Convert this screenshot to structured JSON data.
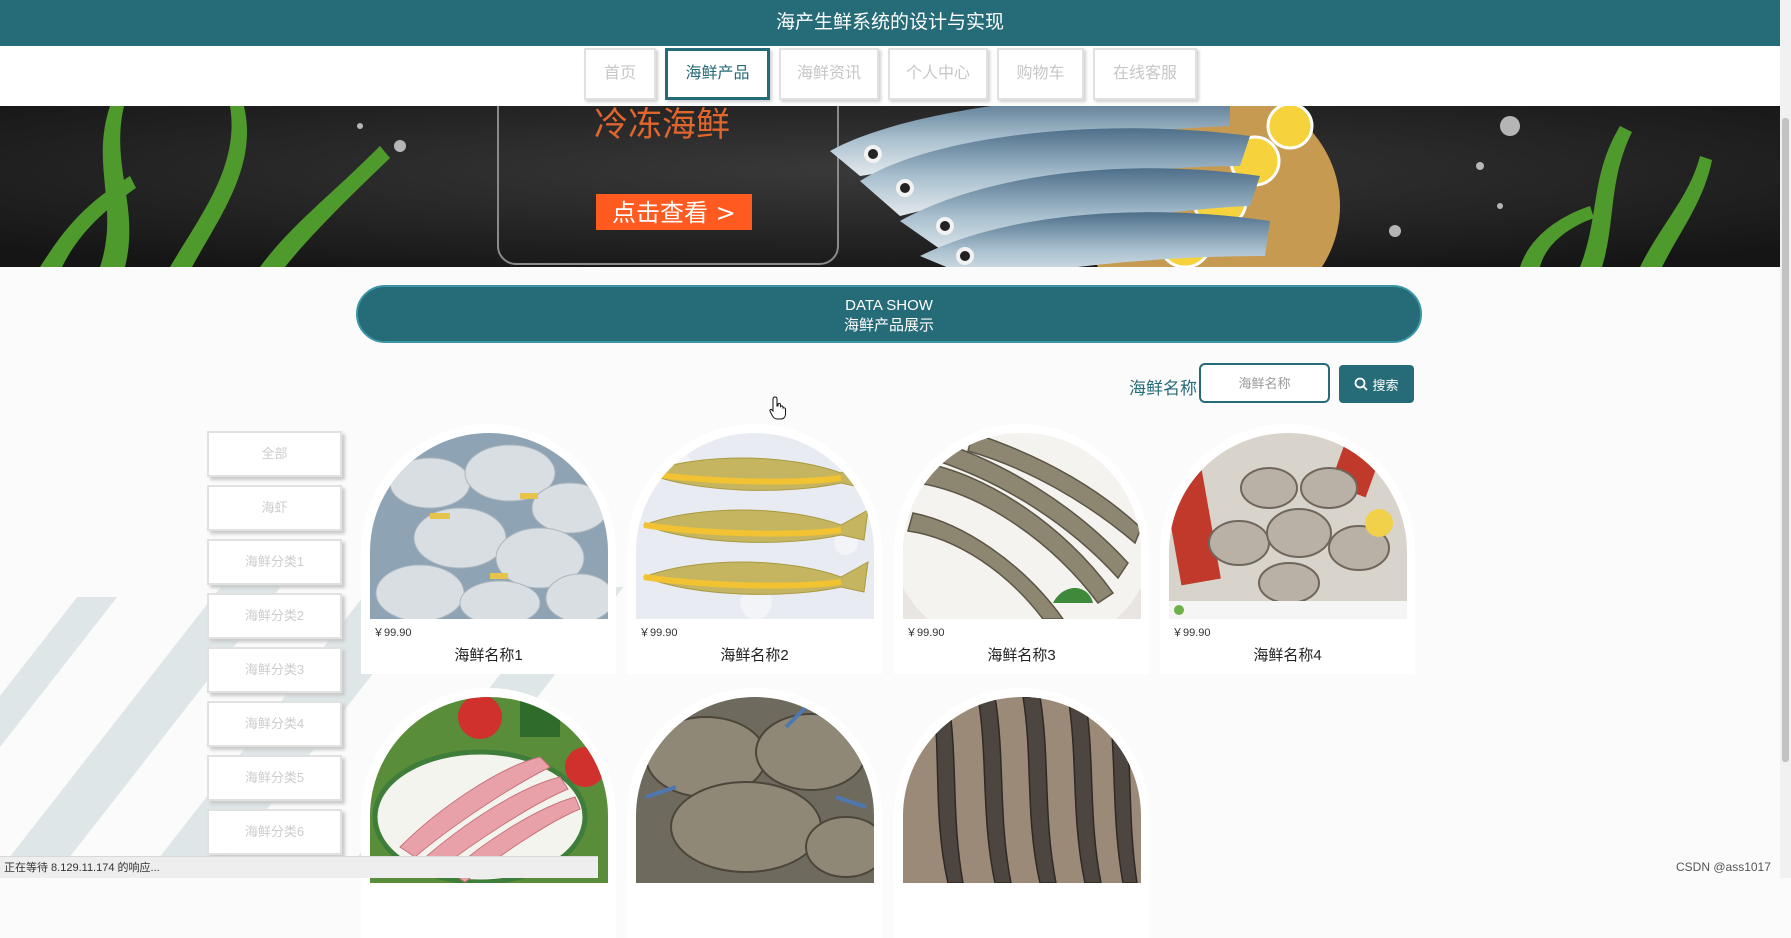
{
  "header": {
    "title": "海产生鲜系统的设计与实现"
  },
  "nav": {
    "items": [
      {
        "label": "首页",
        "active": false
      },
      {
        "label": "海鲜产品",
        "active": true
      },
      {
        "label": "海鲜资讯",
        "active": false
      },
      {
        "label": "个人中心",
        "active": false
      },
      {
        "label": "购物车",
        "active": false
      },
      {
        "label": "在线客服",
        "active": false
      }
    ]
  },
  "banner": {
    "headline": "冷冻海鲜",
    "cta": "点击查看 >"
  },
  "section": {
    "title_en": "DATA SHOW",
    "title_zh": "海鲜产品展示"
  },
  "search": {
    "label": "海鲜名称",
    "placeholder": "海鲜名称",
    "button": "搜索",
    "icon": "search-icon"
  },
  "categories": [
    "全部",
    "海虾",
    "海鲜分类1",
    "海鲜分类2",
    "海鲜分类3",
    "海鲜分类4",
    "海鲜分类5",
    "海鲜分类6"
  ],
  "products": [
    {
      "name": "海鲜名称1",
      "price": "￥99.90"
    },
    {
      "name": "海鲜名称2",
      "price": "￥99.90"
    },
    {
      "name": "海鲜名称3",
      "price": "￥99.90"
    },
    {
      "name": "海鲜名称4",
      "price": "￥99.90"
    },
    {
      "name": "",
      "price": ""
    },
    {
      "name": "",
      "price": ""
    },
    {
      "name": "",
      "price": ""
    }
  ],
  "status": {
    "text": "正在等待 8.129.11.174 的响应...",
    "watermark": "CSDN @ass1017"
  },
  "colors": {
    "primary": "#266b78",
    "border": "#e1e1e1",
    "cta": "#ff5a1f"
  }
}
